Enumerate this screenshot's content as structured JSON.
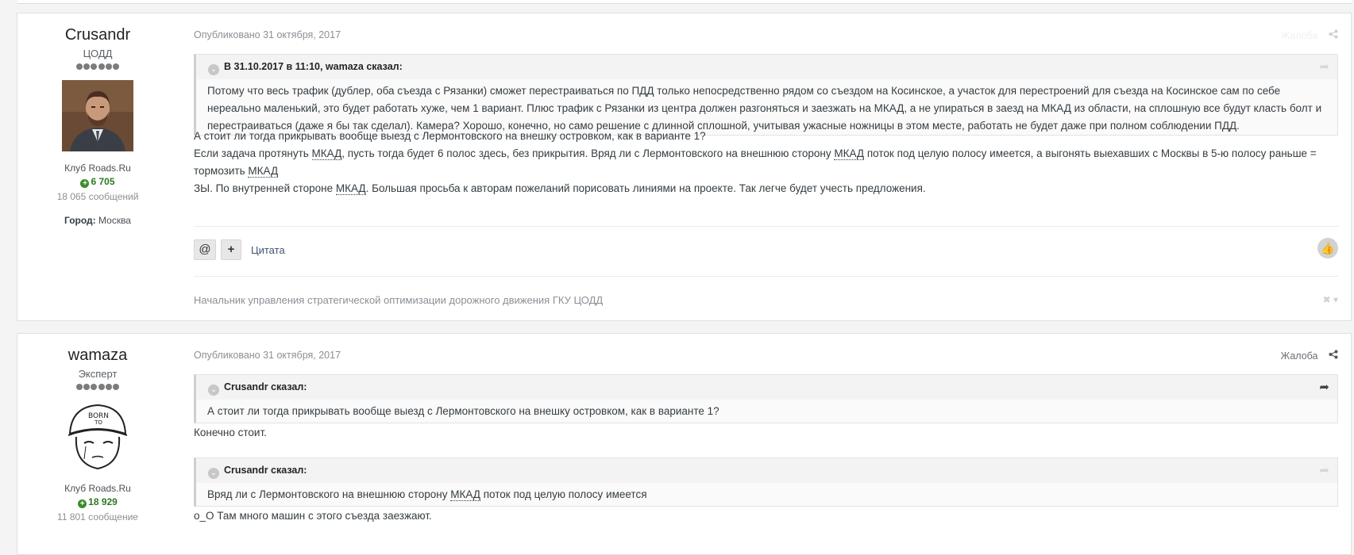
{
  "posts": [
    {
      "author": {
        "name": "Crusandr",
        "rank": "ЦОДД",
        "group": "Клуб Roads.Ru",
        "reputation": "6 705",
        "post_count": "18 065 сообщений",
        "city_label": "Город:",
        "city": "Москва"
      },
      "published": "Опубликовано 31 октября, 2017",
      "report": "Жалоба",
      "quote": {
        "header": "В 31.10.2017 в 11:10, wamaza сказал:",
        "text": "Потому что весь трафик (дублер, оба съезда с Рязанки) сможет перестраиваться по ПДД только непосредственно рядом со съездом на Косинское, а участок для перестроений для съезда на Косинское сам по себе нереально маленький, это будет работать хуже, чем 1 вариант. Плюс трафик с Рязанки из центра должен разгоняться и заезжать на МКАД, а не упираться в заезд на МКАД из области, на сплошную все будут класть болт и перестраиваться (даже я бы так сделал). Камера? Хорошо, конечно, но само решение с длинной сплошной, учитывая ужасные ножницы в этом месте, работать не будет даже при полном соблюдении ПДД."
      },
      "body": {
        "line1": "А стоит ли тогда прикрывать вообще выезд с Лермонтовского на внешку островком, как в варианте 1?",
        "line2_a": "Если задача протянуть ",
        "line2_b": ", пусть тогда будет 6 полос здесь, без прикрытия. Вряд ли с Лермонтовского на внешнюю сторону ",
        "line2_c": " поток под целую полосу имеется, а выгонять выехавших с Москвы в 5-ю полосу раньше = тормозить ",
        "line3_a": "ЗЫ. По внутренней стороне ",
        "line3_b": ". Большая просьба к авторам пожеланий порисовать линиями на проекте. Так легче будет учесть предложения.",
        "abbr": "МКАД"
      },
      "actions": {
        "mention": "@",
        "multiquote": "+",
        "quote": "Цитата"
      },
      "signature": "Начальник управления стратегической оптимизации дорожного движения ГКУ ЦОДД"
    },
    {
      "author": {
        "name": "wamaza",
        "rank": "Эксперт",
        "group": "Клуб Roads.Ru",
        "reputation": "18 929",
        "post_count": "11 801 сообщение"
      },
      "published": "Опубликовано 31 октября, 2017",
      "report": "Жалоба",
      "quote1": {
        "header": "Crusandr сказал:",
        "text": "А стоит ли тогда прикрывать вообще выезд с Лермонтовского на внешку островком, как в варианте 1?"
      },
      "reply1": "Конечно стоит.",
      "quote2": {
        "header": "Crusandr сказал:",
        "text_a": "Вряд ли с Лермонтовского на внешнюю сторону ",
        "abbr": "МКАД",
        "text_b": " поток под целую полосу имеется"
      },
      "reply2": "o_O Там много машин с этого съезда заезжают."
    }
  ],
  "icons": {
    "share": "share-icon",
    "chevron": "chevron-down-icon",
    "like": "thumbs-up-icon",
    "reputation": "plus-circle-icon"
  },
  "colors": {
    "reputation": "#2b7a1f",
    "link": "#3f5673",
    "meta": "#8b9095"
  }
}
